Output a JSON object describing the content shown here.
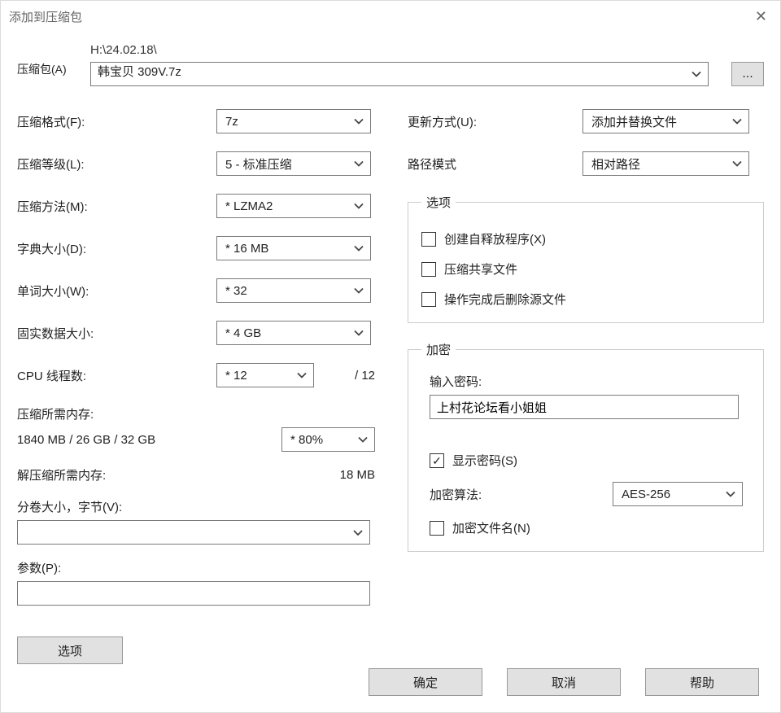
{
  "window": {
    "title": "添加到压缩包"
  },
  "archive": {
    "label": "压缩包(A)",
    "path": "H:\\24.02.18\\",
    "filename": "韩宝贝 309V.7z",
    "browse_label": "..."
  },
  "left": {
    "format": {
      "label": "压缩格式(F):",
      "value": "7z"
    },
    "level": {
      "label": "压缩等级(L):",
      "value": "5 - 标准压缩"
    },
    "method": {
      "label": "压缩方法(M):",
      "value": "* LZMA2"
    },
    "dict": {
      "label": "字典大小(D):",
      "value": "* 16 MB"
    },
    "word": {
      "label": "单词大小(W):",
      "value": "* 32"
    },
    "solid": {
      "label": "固实数据大小:",
      "value": "* 4 GB"
    },
    "threads": {
      "label": "CPU 线程数:",
      "value": "* 12",
      "total": "/ 12"
    },
    "mem_compress": {
      "label": "压缩所需内存:",
      "value": "1840 MB / 26 GB / 32 GB",
      "pct": "* 80%"
    },
    "mem_decompress": {
      "label": "解压缩所需内存:",
      "value": "18 MB"
    },
    "volume": {
      "label": "分卷大小，字节(V):",
      "value": ""
    },
    "params": {
      "label": "参数(P):",
      "value": ""
    },
    "options_btn": "选项"
  },
  "right": {
    "update": {
      "label": "更新方式(U):",
      "value": "添加并替换文件"
    },
    "pathmode": {
      "label": "路径模式",
      "value": "相对路径"
    },
    "options_group": {
      "legend": "选项",
      "sfx": "创建自释放程序(X)",
      "shared": "压缩共享文件",
      "delafter": "操作完成后删除源文件"
    },
    "encrypt_group": {
      "legend": "加密",
      "pw_label": "输入密码:",
      "pw_value": "上村花论坛看小姐姐",
      "show_pw": "显示密码(S)",
      "alg_label": "加密算法:",
      "alg_value": "AES-256",
      "enc_fname": "加密文件名(N)"
    }
  },
  "buttons": {
    "ok": "确定",
    "cancel": "取消",
    "help": "帮助"
  }
}
